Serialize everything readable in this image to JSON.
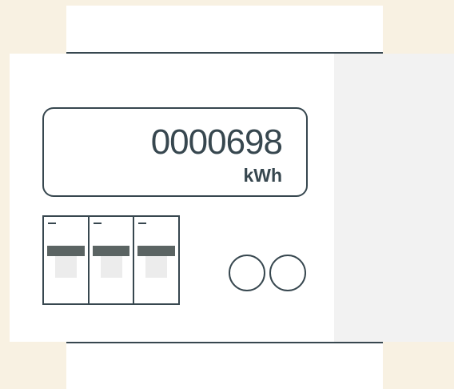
{
  "meter": {
    "reading": "0000698",
    "unit": "kWh",
    "breaker_count": 3,
    "indicator_count": 2,
    "colors": {
      "background": "#f8f1e2",
      "body": "#ffffff",
      "side_panel": "#f2f2f2",
      "outline": "#37474f",
      "toggle": "#5b6463"
    }
  }
}
